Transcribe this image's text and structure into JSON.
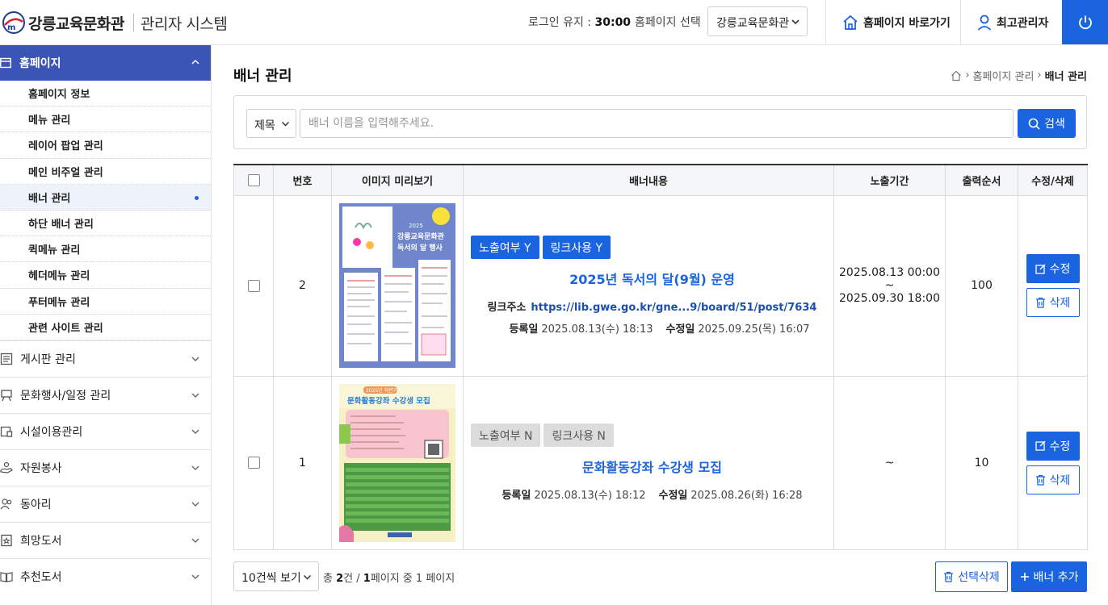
{
  "header": {
    "logo_name": "강릉교육문화관",
    "logo_sub": "관리자 시스템",
    "session_label": "로그인 유지 :",
    "session_time": "30:00",
    "homepage_select_label": "홈페이지 선택",
    "homepage_select_value": "강릉교육문화관",
    "go_homepage": "홈페이지 바로가기",
    "admin_name": "최고관리자"
  },
  "sidebar": {
    "open_section": "홈페이지",
    "sub_items": [
      {
        "label": "홈페이지 정보"
      },
      {
        "label": "메뉴 관리"
      },
      {
        "label": "레이어 팝업 관리"
      },
      {
        "label": "메인 비주얼 관리"
      },
      {
        "label": "배너 관리",
        "active": true
      },
      {
        "label": "하단 배너 관리"
      },
      {
        "label": "퀵메뉴 관리"
      },
      {
        "label": "헤더메뉴 관리"
      },
      {
        "label": "푸터메뉴 관리"
      },
      {
        "label": "관련 사이트 관리"
      }
    ],
    "sections": [
      {
        "label": "게시판 관리",
        "icon": "board-icon"
      },
      {
        "label": "문화행사/일정 관리",
        "icon": "event-icon"
      },
      {
        "label": "시설이용관리",
        "icon": "facility-icon"
      },
      {
        "label": "자원봉사",
        "icon": "volunteer-icon"
      },
      {
        "label": "동아리",
        "icon": "club-icon"
      },
      {
        "label": "희망도서",
        "icon": "wish-book-icon"
      },
      {
        "label": "추천도서",
        "icon": "recommend-book-icon"
      }
    ]
  },
  "page": {
    "title": "배너 관리",
    "breadcrumb": [
      "홈페이지 관리",
      "배너 관리"
    ]
  },
  "search": {
    "field_select": "제목",
    "placeholder": "배너 이름을 입력해주세요.",
    "button": "검색"
  },
  "table": {
    "headers": [
      "번호",
      "이미지 미리보기",
      "배너내용",
      "노출기간",
      "출력순서",
      "수정/삭제"
    ],
    "rows": [
      {
        "no": "2",
        "badge_expose": "노출여부 Y",
        "badge_link": "링크사용 Y",
        "title": "2025년 독서의 달(9월) 운영",
        "link_label": "링크주소",
        "link_url": "https://lib.gwe.go.kr/gne...9/board/51/post/7634",
        "reg_label": "등록일",
        "reg_date": "2025.08.13(수) 18:13",
        "mod_label": "수정일",
        "mod_date": "2025.09.25(목) 16:07",
        "period_start": "2025.08.13 00:00 ~",
        "period_end": "2025.09.30 18:00",
        "order": "100",
        "edit": "수정",
        "delete": "삭제",
        "thumb_title_line1": "강릉교육문화관",
        "thumb_title_line2": "독서의 달 행사",
        "thumb_year": "2025"
      },
      {
        "no": "1",
        "badge_expose": "노출여부 N",
        "badge_link": "링크사용 N",
        "title": "문화활동강좌 수강생 모집",
        "reg_label": "등록일",
        "reg_date": "2025.08.13(수) 18:12",
        "mod_label": "수정일",
        "mod_date": "2025.08.26(화) 16:28",
        "period": "~",
        "order": "10",
        "edit": "수정",
        "delete": "삭제",
        "thumb_year": "2025년 하반기",
        "thumb_title": "문화활동강좌 수강생 모집"
      }
    ]
  },
  "footer": {
    "page_size": "10건씩 보기",
    "total_prefix": "총",
    "total_count": "2",
    "total_unit": "건 /",
    "current_page": "1",
    "page_suffix": "페이지 중 1 페이지",
    "select_delete": "선택삭제",
    "add_banner": "배너 추가"
  },
  "colors": {
    "accent": "#1a64e0",
    "sidebar_active": "#3a55b6"
  }
}
